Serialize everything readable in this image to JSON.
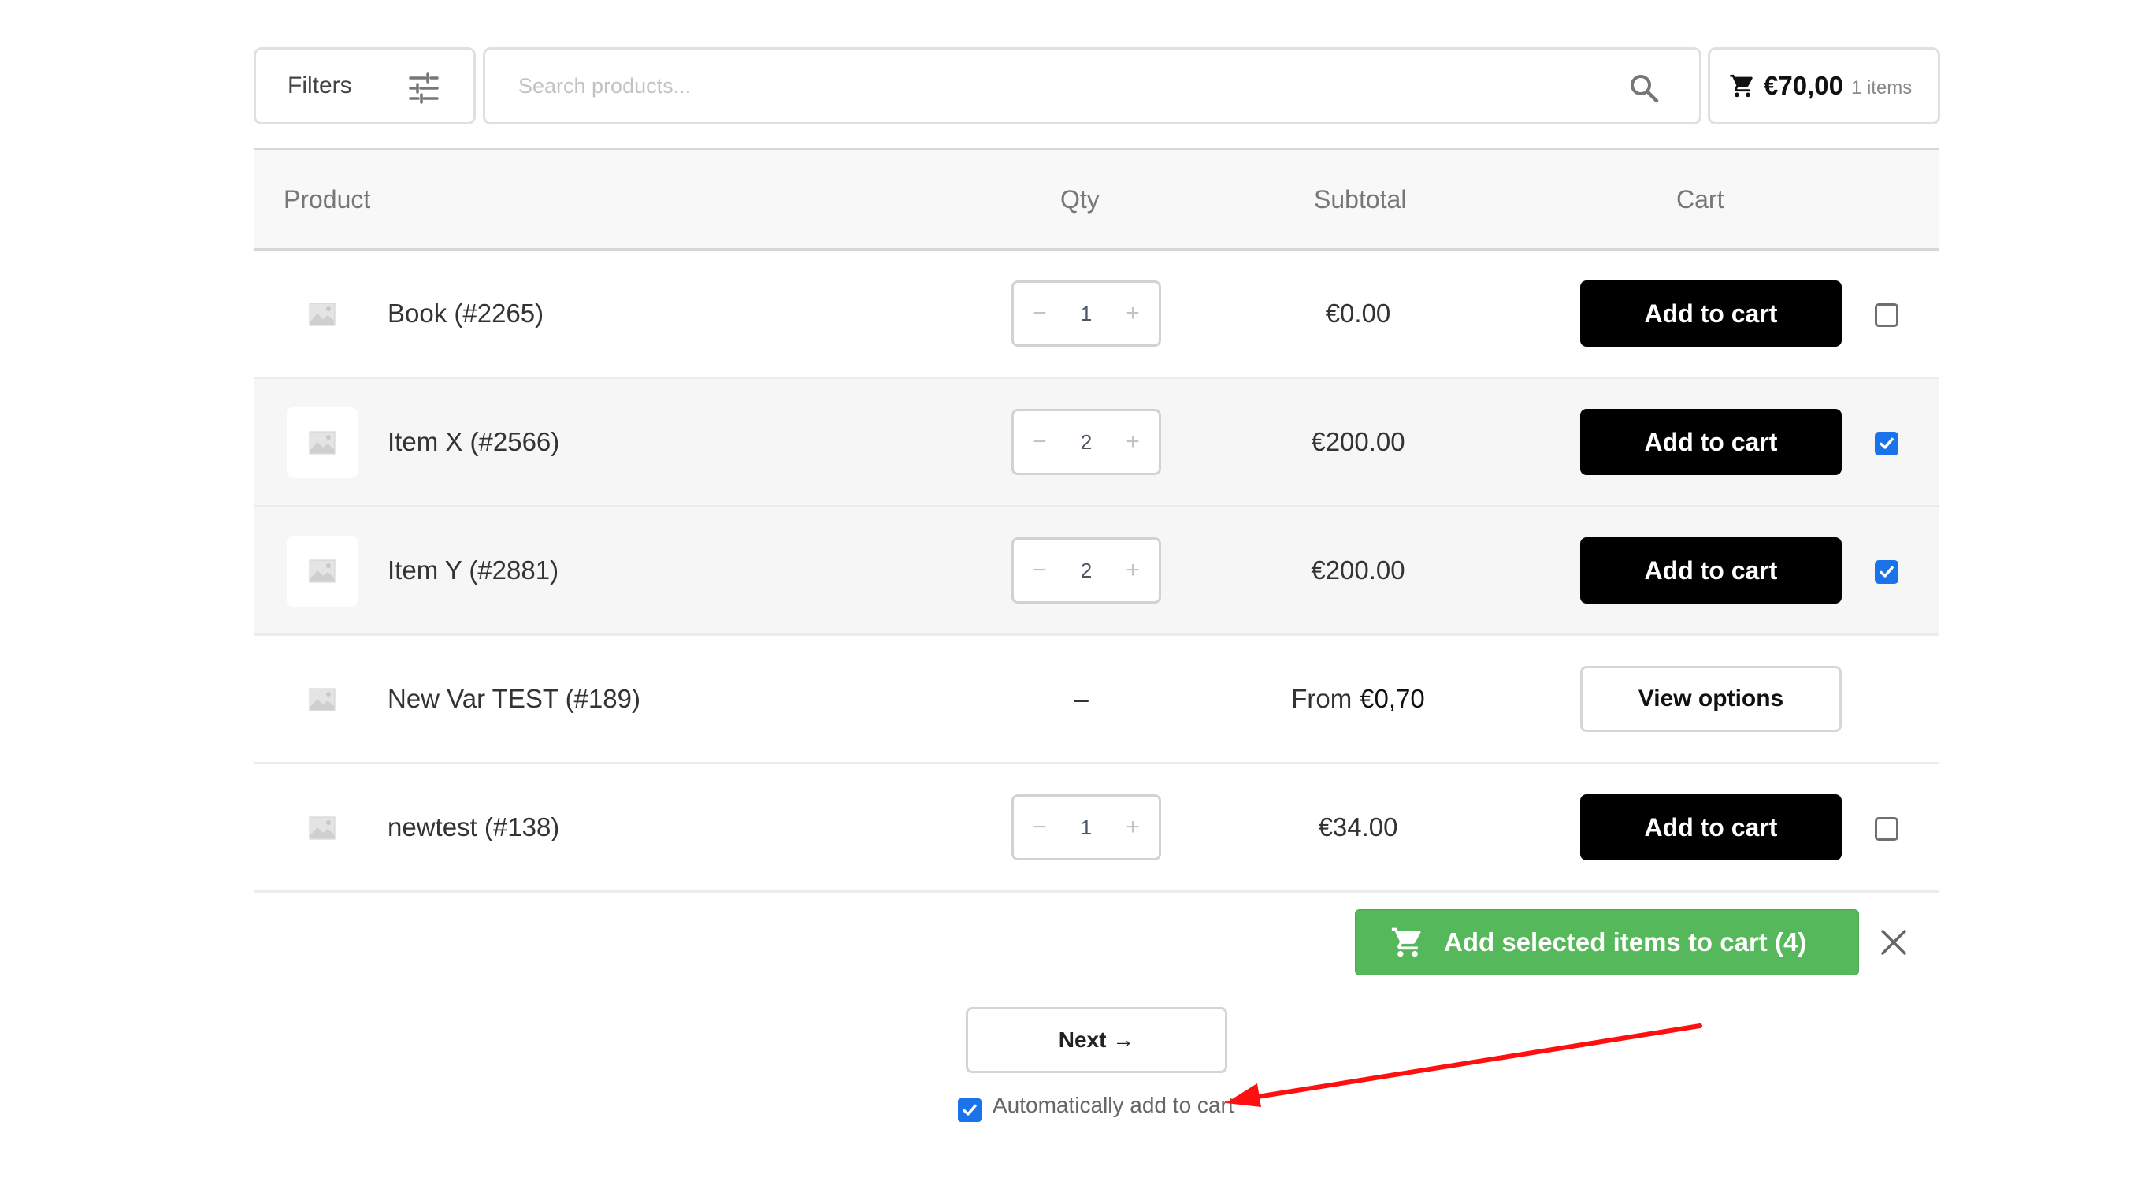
{
  "toolbar": {
    "filters_label": "Filters",
    "search_placeholder": "Search products...",
    "search_value": "",
    "cart_total": "€70,00",
    "cart_count": "1 items"
  },
  "table": {
    "headers": [
      "Product",
      "Qty",
      "Subtotal",
      "Cart"
    ],
    "rows": [
      {
        "name": "Book (#2265)",
        "qty": "1",
        "subtotal": "€0.00",
        "action": "Add to cart",
        "selected": false
      },
      {
        "name": "Item X (#2566)",
        "qty": "2",
        "subtotal": "€200.00",
        "action": "Add to cart",
        "selected": true
      },
      {
        "name": "Item Y (#2881)",
        "qty": "2",
        "subtotal": "€200.00",
        "action": "Add to cart",
        "selected": true
      },
      {
        "name": "New Var TEST (#189)",
        "qty": "–",
        "subtotal_prefix": "From",
        "subtotal": "€0,70",
        "action": "View options"
      },
      {
        "name": "newtest (#138)",
        "qty": "1",
        "subtotal": "€34.00",
        "action": "Add to cart",
        "selected": false
      }
    ],
    "stepper_minus": "−",
    "stepper_plus": "+"
  },
  "bulk": {
    "add_selected_label": "Add selected items to cart (4)",
    "accent_color": "#55b85a"
  },
  "pagination": {
    "next_label": "Next →"
  },
  "auto_add": {
    "label": "Automatically add to cart",
    "checked": true
  },
  "annotation": {
    "arrow_color": "#ff1010"
  }
}
